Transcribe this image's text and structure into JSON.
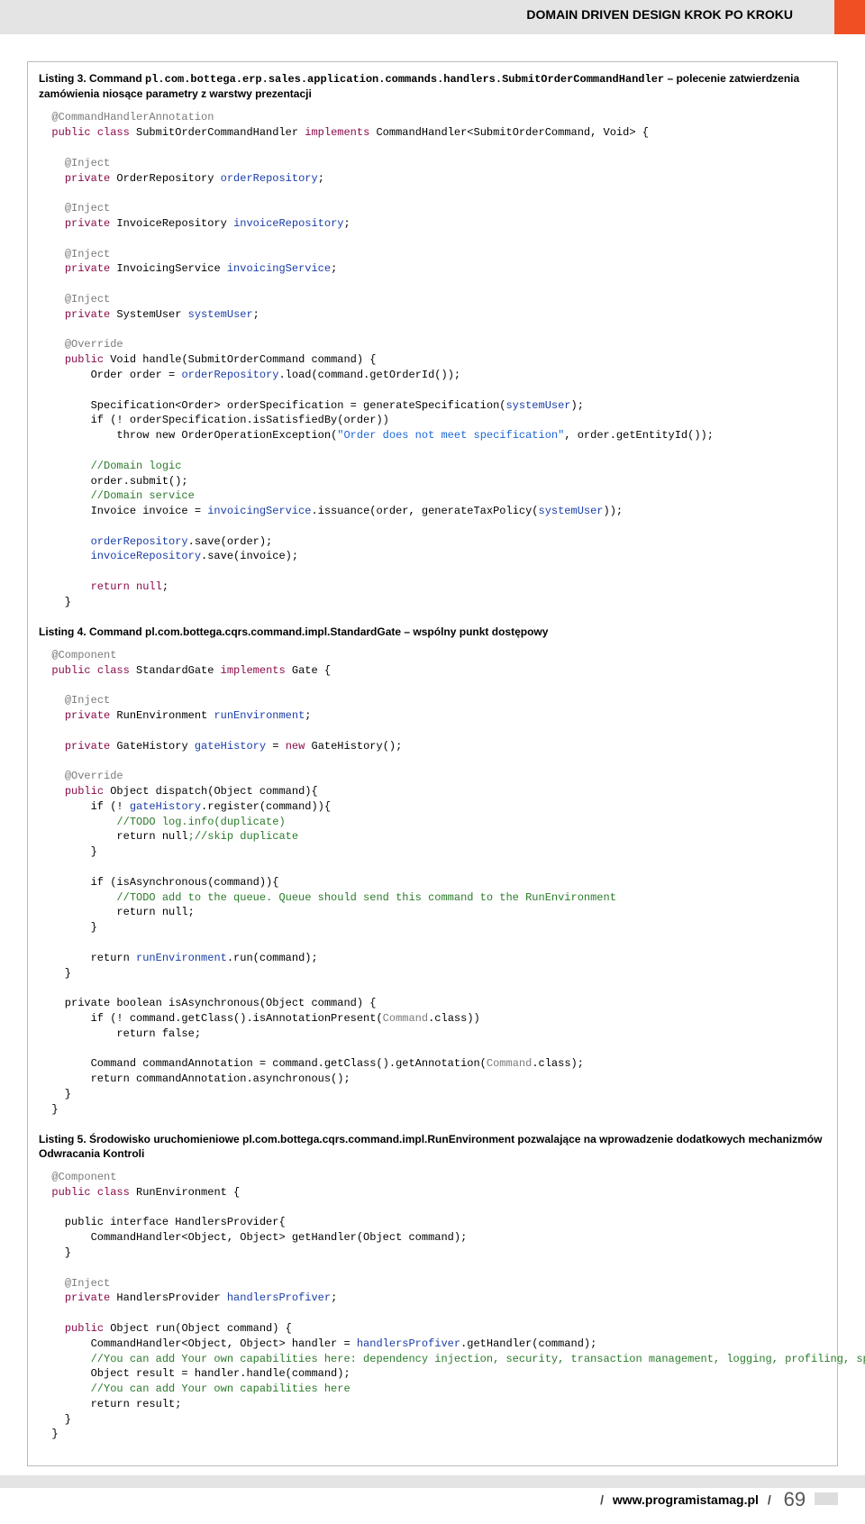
{
  "header": {
    "title": "DOMAIN DRIVEN DESIGN KROK PO KROKU"
  },
  "listings": {
    "l3": {
      "prefix": "Listing 3. Command ",
      "classpath": "pl.com.bottega.erp.sales.application.commands.handlers.SubmitOrderCommandHandler",
      "suffix": " – polecenie zatwierdzenia zamówienia niosące parametry z warstwy prezentacji"
    },
    "l4": {
      "text": "Listing 4. Command pl.com.bottega.cqrs.command.impl.StandardGate – wspólny punkt dostępowy"
    },
    "l5": {
      "text": "Listing 5. Środowisko uruchomieniowe pl.com.bottega.cqrs.command.impl.RunEnvironment pozwalające na wprowadzenie dodatkowych mechanizmów Odwracania Kontroli"
    }
  },
  "code": {
    "l3_ann_chandler": "@CommandHandlerAnnotation",
    "l3_public_class": "public class",
    "l3_clsname": " SubmitOrderCommandHandler ",
    "l3_impl": "implements",
    "l3_impl_tail": " CommandHandler<SubmitOrderCommand, Void> {",
    "inject": "@Inject",
    "private": "private",
    "orderRepo_type": " OrderRepository ",
    "orderRepo_name": "orderRepository",
    "semi": ";",
    "invoiceRepo_type": " InvoiceRepository ",
    "invoiceRepo_name": "invoiceRepository",
    "invoicingSvc_type": " InvoicingService ",
    "invoicingSvc_name": "invoicingService",
    "sysUser_type": " SystemUser ",
    "sysUser_name": "systemUser",
    "override": "@Override",
    "public": "public",
    "l3_handle_sig": " Void handle(SubmitOrderCommand command) {",
    "l3_order_assign_a": "        Order order = ",
    "l3_order_assign_b": ".load(command.getOrderId());",
    "l3_spec_a": "        Specification<Order> orderSpecification = generateSpecification(",
    "l3_spec_b": ");",
    "l3_if_spec": "        if (! orderSpecification.isSatisfiedBy(order))",
    "l3_throw_a": "            throw new",
    "l3_throw_b": " OrderOperationException(",
    "l3_throw_str": "\"Order does not meet specification\"",
    "l3_throw_c": ", order.getEntityId());",
    "l3_cm_domainlogic": "        //Domain logic",
    "l3_submit": "        order.submit();",
    "l3_cm_domainsvc": "        //Domain service",
    "l3_invoice_a": "        Invoice invoice = ",
    "l3_invoice_b": ".issuance(order, generateTaxPolicy(",
    "l3_invoice_c": "));",
    "l3_saveorder": ".save(order);",
    "l3_saveinvoice": ".save(invoice);",
    "return_null": "return null",
    "brace_close": "    }",
    "l4_component": "@Component",
    "l4_clsname": " StandardGate ",
    "l4_impl_tail": " Gate {",
    "runEnv_type": " RunEnvironment ",
    "runEnv_name": "runEnvironment",
    "gateHist_decl_a": " GateHistory ",
    "gateHist_name": "gateHistory",
    "gateHist_decl_b": " = ",
    "new": "new",
    "gateHist_decl_c": " GateHistory();",
    "l4_dispatch_sig": " Object dispatch(Object command){",
    "l4_if_reg_a": "        if (! ",
    "l4_if_reg_b": ".register(command)){",
    "l4_todo1": "            //TODO log.info(duplicate)",
    "l4_retnull_skip_a": "            return null",
    "l4_retnull_skip_b": ";//skip duplicate",
    "l4_brace_close2": "        }",
    "l4_if_async": "        if (isAsynchronous(command)){",
    "l4_todo2": "            //TODO add to the queue. Queue should send this command to the RunEnvironment",
    "l4_retnull2": "            return null;",
    "l4_ret_run_a": "        return ",
    "l4_ret_run_b": ".run(command);",
    "l4_isasync_sig_a": "    private boolean",
    "l4_isasync_sig_b": " isAsynchronous(Object command) {",
    "l4_if_notann_a": "        if (! command.getClass().isAnnotationPresent(",
    "command_type": "Command",
    "dot_class": ".class",
    "l4_if_notann_b": "))",
    "l4_retfalse": "            return false",
    "l4_cmdann_a": "        Command commandAnnotation = command.getClass().getAnnotation(",
    "l4_cmdann_b": ");",
    "l4_ret_async": "        return commandAnnotation.asynchronous();",
    "outer_brace": "}",
    "l5_clsname": " RunEnvironment {",
    "l5_iface_a": "    public interface",
    "l5_iface_b": " HandlersProvider{",
    "l5_iface_method": "        CommandHandler<Object, Object> getHandler(Object command);",
    "l5_brace_close": "    }",
    "handlersProv_type": " HandlersProvider ",
    "handlersProv_name": "handlersProfiver",
    "l5_run_sig": " Object run(Object command) {",
    "l5_handler_a": "        CommandHandler<Object, Object> handler = ",
    "l5_handler_b": ".getHandler(command);",
    "l5_cm1": "        //You can add Your own capabilities here: dependency injection, security, transaction management, logging, profiling, spying, storing commands, etc",
    "l5_result": "        Object result = handler.handle(command);",
    "l5_cm2": "        //You can add Your own capabilities here",
    "l5_retresult": "        return result;"
  },
  "footer": {
    "site": "www.programistamag.pl",
    "page": "69"
  }
}
